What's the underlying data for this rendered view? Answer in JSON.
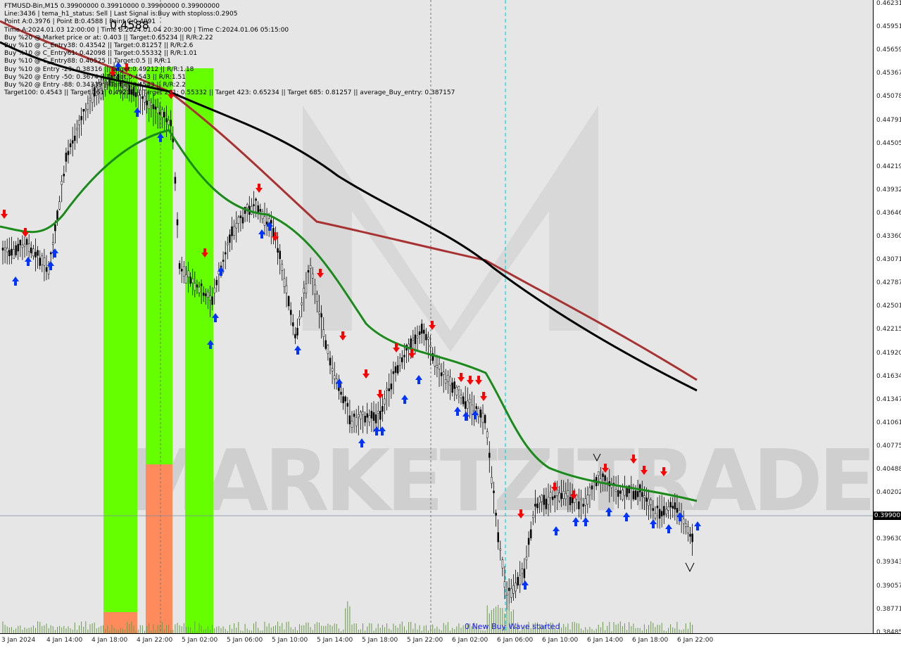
{
  "header": {
    "symbol_line": "FTMUSD-Bin,M15  0.39900000 0.39910000 0.39900000 0.39900000",
    "line2": "Line:3436  |  tema_h1_status: Sell  |  Last Signal is:Buy with stoploss:0.2905",
    "line3": "Point A:0.3976  |  Point B:0.4588  |  Point C:0.4091",
    "line4": "Time A:2024.01.03 12:00:00  |  Time B:2024.01.04 20:30:00  |  Time C:2024.01.06 05:15:00",
    "line5": "Buy %20 @ Market price or at: 0.403  ||  Target:0.65234  ||  R/R:2.22",
    "line6": "Buy %10 @ C_Entry38: 0.43542  ||  Target:0.81257  ||  R/R:2.6",
    "line7": "Buy %10 @ C_Entry61: 0.42098  ||  Target:0.55332  ||  R/R:1.01",
    "line8": "Buy %10 @ C_Entry88: 0.40525  ||  Target:0.5  ||  R/R:1",
    "line9": "Buy %10 @ Entry -23: 0.38316  ||  Target:0.49212  ||  R/R:1.18",
    "line10": "Buy %20 @ Entry -50: 0.3674  ||  Target:0.4543  ||  R/R:1.51",
    "line11": "Buy %20 @ Entry -88: 0.34339  ||  Target:0.4543  ||  R/R:2.2",
    "line12": "Target100: 0.4543  ||  Target 161: 0.49212  ||  Target 261: 0.55332  ||  Target 423: 0.65234  ||  Target 685: 0.81257  ||  average_Buy_entry: 0.387157",
    "big_price": "0.4588"
  },
  "watermark": "MARKETZITRADE",
  "wave_label": "0 New Buy Wave started",
  "current_price_label": "0.39900",
  "colors": {
    "green_band": "#66ff00",
    "orange_band": "#ff8a5c",
    "ma_green": "#1a8a1a",
    "ma_red": "#a83232",
    "ma_black": "#000000",
    "buy_arrow": "#0033ff",
    "sell_arrow": "#ff0000",
    "candle": "#000000"
  },
  "y_axis": [
    "0.46231",
    "0.45951",
    "0.45659",
    "0.45367",
    "0.45078",
    "0.44791",
    "0.44505",
    "0.44219",
    "0.43932",
    "0.43646",
    "0.43360",
    "0.43071",
    "0.42787",
    "0.42501",
    "0.42215",
    "0.41920",
    "0.41634",
    "0.41347",
    "0.41061",
    "0.40775",
    "0.40488",
    "0.40202",
    "0.39916",
    "0.39630",
    "0.39343",
    "0.39057",
    "0.38771",
    "0.38485"
  ],
  "x_axis": [
    "3 Jan 2024",
    "4 Jan 14:00",
    "4 Jan 18:00",
    "4 Jan 22:00",
    "5 Jan 02:00",
    "5 Jan 06:00",
    "5 Jan 10:00",
    "5 Jan 14:00",
    "5 Jan 18:00",
    "5 Jan 22:00",
    "6 Jan 02:00",
    "6 Jan 06:00",
    "6 Jan 10:00",
    "6 Jan 14:00",
    "6 Jan 18:00",
    "6 Jan 22:00"
  ]
}
